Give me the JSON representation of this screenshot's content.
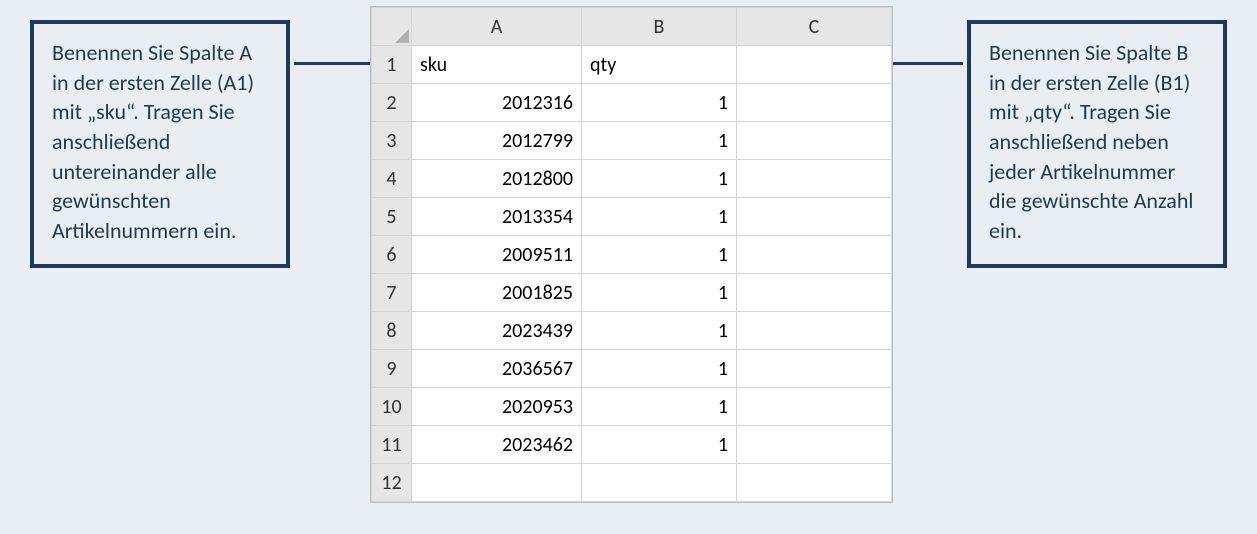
{
  "callouts": {
    "left": "Benennen Sie Spalte A in der ersten Zelle (A1) mit „sku“. Tragen Sie anschließend untereinander alle gewünschten Artikelnummern ein.",
    "right": "Benennen Sie Spalte B in der ersten Zelle (B1) mit „qty“. Tragen Sie anschließend neben jeder Artikelnummer die gewünschte Anzahl ein."
  },
  "sheet": {
    "columns": [
      "A",
      "B",
      "C"
    ],
    "row_numbers": [
      "1",
      "2",
      "3",
      "4",
      "5",
      "6",
      "7",
      "8",
      "9",
      "10",
      "11",
      "12"
    ],
    "header_row": {
      "a": "sku",
      "b": "qty",
      "c": ""
    },
    "data_rows": [
      {
        "a": "2012316",
        "b": "1",
        "c": ""
      },
      {
        "a": "2012799",
        "b": "1",
        "c": ""
      },
      {
        "a": "2012800",
        "b": "1",
        "c": ""
      },
      {
        "a": "2013354",
        "b": "1",
        "c": ""
      },
      {
        "a": "2009511",
        "b": "1",
        "c": ""
      },
      {
        "a": "2001825",
        "b": "1",
        "c": ""
      },
      {
        "a": "2023439",
        "b": "1",
        "c": ""
      },
      {
        "a": "2036567",
        "b": "1",
        "c": ""
      },
      {
        "a": "2020953",
        "b": "1",
        "c": ""
      },
      {
        "a": "2023462",
        "b": "1",
        "c": ""
      },
      {
        "a": "",
        "b": "",
        "c": ""
      }
    ]
  }
}
